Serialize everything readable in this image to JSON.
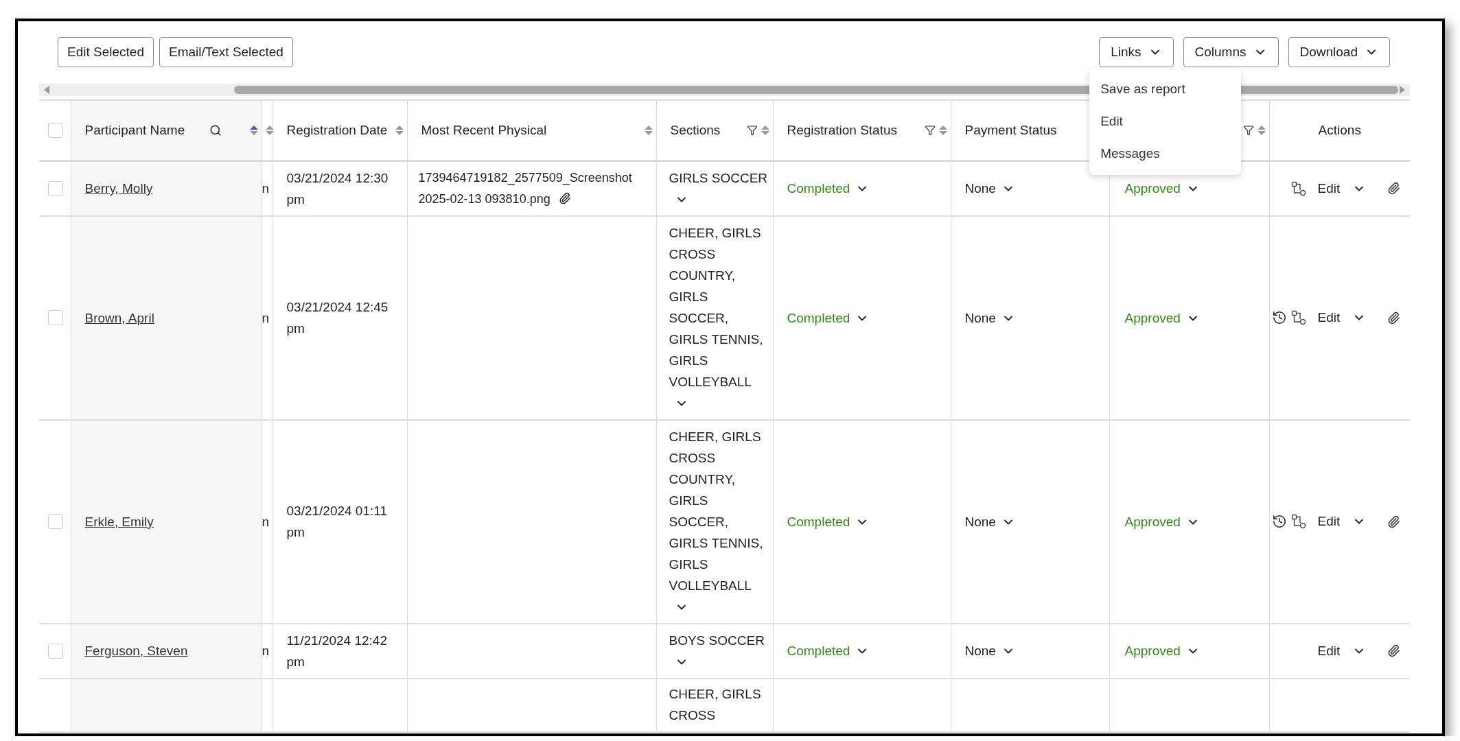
{
  "toolbar": {
    "left_buttons": [
      "Edit Selected",
      "Email/Text Selected"
    ],
    "menus": [
      {
        "label": "Links",
        "items": [
          "Save as report",
          "Edit",
          "Messages"
        ]
      },
      {
        "label": "Columns"
      },
      {
        "label": "Download"
      }
    ]
  },
  "table": {
    "select_all": {
      "checked": false
    },
    "columns": [
      {
        "label": "Participant Name",
        "search": true,
        "sortable": true,
        "sorted": true
      },
      {
        "sortable": true,
        "sorted": false
      },
      {
        "label": "Registration Date",
        "sortable": true,
        "sorted": false
      },
      {
        "label": "Most Recent Physical",
        "sortable": true,
        "sorted": false
      },
      {
        "label": "Sections",
        "filter": true,
        "sortable": true,
        "sorted": false
      },
      {
        "label": "Registration Status",
        "filter": true,
        "sortable": true,
        "sorted": false
      },
      {
        "label": "Payment Status"
      },
      {
        "filter": true,
        "sortable": true,
        "sorted": false
      },
      {
        "label": "Actions"
      }
    ],
    "rows": [
      {
        "selected": false,
        "name": "Berry, Molly",
        "column_2": "n",
        "registration_date": "03/21/2024 12:30 pm",
        "physical": "1739464719182_2577509_Screenshot 2025-02-13 093810.png",
        "sections": "GIRLS SOCCER",
        "registration_status": "Completed",
        "payment_status": "None",
        "column_8": "Approved",
        "history": false,
        "workflow": true,
        "action": "Edit",
        "attachment": true
      },
      {
        "selected": false,
        "name": "Brown, April",
        "column_2": "n",
        "registration_date": "03/21/2024 12:45 pm",
        "sections": "CHEER, GIRLS CROSS COUNTRY, GIRLS SOCCER, GIRLS TENNIS, GIRLS VOLLEYBALL",
        "registration_status": "Completed",
        "payment_status": "None",
        "column_8": "Approved",
        "history": true,
        "workflow": true,
        "action": "Edit",
        "attachment": true
      },
      {
        "selected": false,
        "name": "Erkle, Emily",
        "column_2": "n",
        "registration_date": "03/21/2024 01:11 pm",
        "sections": "CHEER, GIRLS CROSS COUNTRY, GIRLS SOCCER, GIRLS TENNIS, GIRLS VOLLEYBALL",
        "registration_status": "Completed",
        "payment_status": "None",
        "column_8": "Approved",
        "history": true,
        "workflow": true,
        "action": "Edit",
        "attachment": true
      },
      {
        "selected": false,
        "name": "Ferguson, Steven",
        "column_2": "n",
        "registration_date": "11/21/2024 12:42 pm",
        "sections": "BOYS SOCCER",
        "registration_status": "Completed",
        "payment_status": "None",
        "column_8": "Approved",
        "history": false,
        "workflow": false,
        "action": "Edit",
        "attachment": true
      },
      {
        "sections": "CHEER, GIRLS CROSS"
      }
    ]
  }
}
